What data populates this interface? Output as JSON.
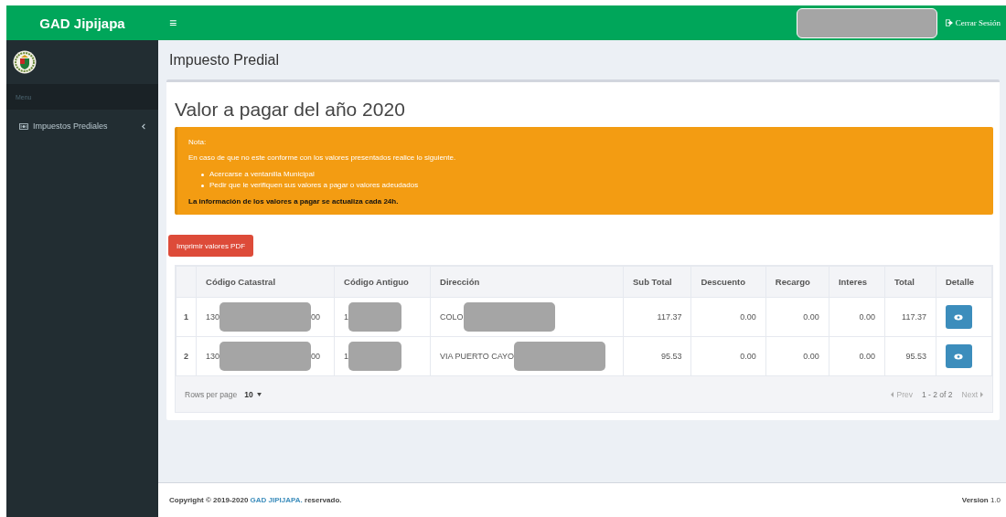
{
  "header": {
    "brand": "GAD Jipijapa",
    "menu_toggle": "≡",
    "logout": "Cerrar Sesión"
  },
  "sidebar": {
    "section": "Menu",
    "items": [
      {
        "label": "Impuestos Prediales",
        "expanded": false
      }
    ]
  },
  "page_title": "Impuesto Predial",
  "heading": "Valor a pagar del año 2020",
  "alert": {
    "title": "Nota:",
    "text": "En caso de que no este conforme con los valores presentados realice lo siguiente.",
    "items": [
      "Acercarse a ventanilla Municipal",
      "Pedir que le verifiquen sus valores a pagar o valores adeudados"
    ],
    "note": "La información de los valores a pagar se actualiza cada 24h."
  },
  "print_button": "Imprimir valores PDF",
  "table": {
    "columns": [
      "",
      "Código Catastral",
      "Código Antiguo",
      "Dirección",
      "Sub Total",
      "Descuento",
      "Recargo",
      "Interes",
      "Total",
      "Detalle"
    ],
    "rows": [
      {
        "cells": [
          {
            "kind": "index",
            "text": "1"
          },
          {
            "kind": "parts",
            "parts": [
              {
                "text": "130"
              },
              {
                "kind": "redacted"
              },
              {
                "text": "00"
              }
            ]
          },
          {
            "kind": "parts",
            "parts": [
              {
                "text": "1"
              },
              {
                "kind": "redacted"
              }
            ]
          },
          {
            "kind": "parts",
            "parts": [
              {
                "text": "COLO"
              },
              {
                "kind": "redacted"
              }
            ]
          },
          {
            "kind": "number",
            "text": "117.37"
          },
          {
            "kind": "number",
            "text": "0.00"
          },
          {
            "kind": "number",
            "text": "0.00"
          },
          {
            "kind": "number",
            "text": "0.00"
          },
          {
            "kind": "number",
            "text": "117.37"
          },
          {
            "kind": "view_button"
          }
        ]
      },
      {
        "cells": [
          {
            "kind": "index",
            "text": "2"
          },
          {
            "kind": "parts",
            "parts": [
              {
                "text": "130"
              },
              {
                "kind": "redacted"
              },
              {
                "text": "00"
              }
            ]
          },
          {
            "kind": "parts",
            "parts": [
              {
                "text": "1"
              },
              {
                "kind": "redacted"
              }
            ]
          },
          {
            "kind": "parts",
            "parts": [
              {
                "text": "VIA PUERTO CAYO"
              },
              {
                "kind": "redacted"
              }
            ]
          },
          {
            "kind": "number",
            "text": "95.53"
          },
          {
            "kind": "number",
            "text": "0.00"
          },
          {
            "kind": "number",
            "text": "0.00"
          },
          {
            "kind": "number",
            "text": "0.00"
          },
          {
            "kind": "number",
            "text": "95.53"
          },
          {
            "kind": "view_button"
          }
        ]
      }
    ],
    "pagination": {
      "rows_label": "Rows per page",
      "rows_value": "10",
      "prev": {
        "label": "Prev",
        "disabled": true
      },
      "range": "1 - 2 of 2",
      "next": {
        "label": "Next",
        "disabled": true
      }
    }
  },
  "footer": {
    "copyright": "Copyright © 2019-2020",
    "link": "GAD JIPIJAPA.",
    "suffix": "reservado.",
    "version": "**Version** 1.0"
  }
}
